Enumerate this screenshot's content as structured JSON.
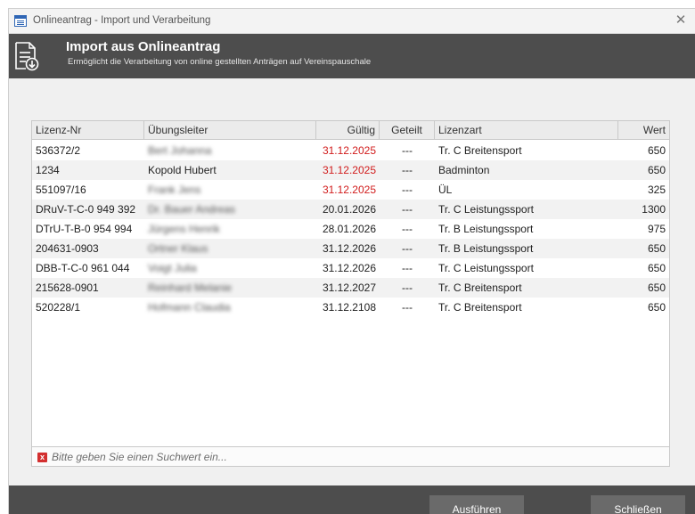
{
  "window": {
    "title": "Onlineantrag - Import und Verarbeitung",
    "close_glyph": "✕"
  },
  "header": {
    "title": "Import aus Onlineantrag",
    "subtitle": "Ermöglicht die Verarbeitung von online gestellten Anträgen auf Vereinspauschale",
    "icon": "document-download-icon"
  },
  "table": {
    "columns": [
      "Lizenz-Nr",
      "Übungsleiter",
      "Gültig",
      "Geteilt",
      "Lizenzart",
      "Wert"
    ],
    "rows": [
      {
        "lizenz": "536372/2",
        "uebungsleiter": "Bert Johanna",
        "gueltig": "31.12.2025",
        "geteilt": "---",
        "lizenzart": "Tr. C Breitensport",
        "wert": "650",
        "expired": true,
        "blurred": true
      },
      {
        "lizenz": "1234",
        "uebungsleiter": "Kopold Hubert",
        "gueltig": "31.12.2025",
        "geteilt": "---",
        "lizenzart": "Badminton",
        "wert": "650",
        "expired": true,
        "blurred": false
      },
      {
        "lizenz": "551097/16",
        "uebungsleiter": "Frank Jens",
        "gueltig": "31.12.2025",
        "geteilt": "---",
        "lizenzart": "ÜL",
        "wert": "325",
        "expired": true,
        "blurred": true
      },
      {
        "lizenz": "DRuV-T-C-0 949 392",
        "uebungsleiter": "Dr. Bauer Andreas",
        "gueltig": "20.01.2026",
        "geteilt": "---",
        "lizenzart": "Tr. C Leistungssport",
        "wert": "1300",
        "expired": false,
        "blurred": true
      },
      {
        "lizenz": "DTrU-T-B-0 954 994",
        "uebungsleiter": "Jürgens Henrik",
        "gueltig": "28.01.2026",
        "geteilt": "---",
        "lizenzart": "Tr. B Leistungssport",
        "wert": "975",
        "expired": false,
        "blurred": true
      },
      {
        "lizenz": "204631-0903",
        "uebungsleiter": "Ortner Klaus",
        "gueltig": "31.12.2026",
        "geteilt": "---",
        "lizenzart": "Tr. B Leistungssport",
        "wert": "650",
        "expired": false,
        "blurred": true
      },
      {
        "lizenz": "DBB-T-C-0 961 044",
        "uebungsleiter": "Voigt Julia",
        "gueltig": "31.12.2026",
        "geteilt": "---",
        "lizenzart": "Tr. C Leistungssport",
        "wert": "650",
        "expired": false,
        "blurred": true
      },
      {
        "lizenz": "215628-0901",
        "uebungsleiter": "Reinhard Melanie",
        "gueltig": "31.12.2027",
        "geteilt": "---",
        "lizenzart": "Tr. C Breitensport",
        "wert": "650",
        "expired": false,
        "blurred": true
      },
      {
        "lizenz": "520228/1",
        "uebungsleiter": "Hofmann Claudia",
        "gueltig": "31.12.2108",
        "geteilt": "---",
        "lizenzart": "Tr. C Breitensport",
        "wert": "650",
        "expired": false,
        "blurred": true
      }
    ]
  },
  "search": {
    "placeholder": "Bitte geben Sie einen Suchwert ein...",
    "value": "",
    "icon": "clear-search-icon",
    "icon_glyph": "x"
  },
  "footer": {
    "run_label": "Ausführen",
    "close_label": "Schließen"
  },
  "colors": {
    "header_bg": "#4d4d4d",
    "expired_text": "#d11c1c",
    "button_bg": "#6a6a6a"
  }
}
